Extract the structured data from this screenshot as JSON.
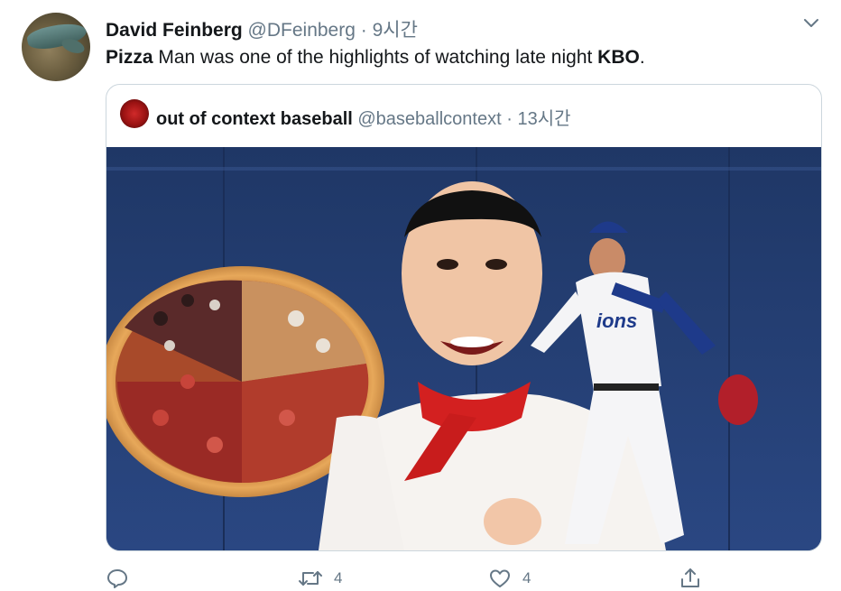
{
  "tweet": {
    "display_name": "David Feinberg",
    "handle": "@DFeinberg",
    "separator": " · ",
    "time": "9시간",
    "text_bold_1": "Pizza",
    "text_mid": " Man was one of the highlights of watching late night ",
    "text_bold_2": "KBO",
    "text_end": "."
  },
  "quoted": {
    "display_name": "out of context baseball",
    "handle": "@baseballcontext",
    "separator": " · ",
    "time": "13시간"
  },
  "actions": {
    "reply_count": "",
    "retweet_count": "4",
    "like_count": "4"
  },
  "icons": [
    "avatar",
    "chevron-down-icon",
    "reply-icon",
    "retweet-icon",
    "like-icon",
    "share-icon"
  ],
  "colors": {
    "text": "#14171a",
    "muted": "#657786",
    "border": "#ccd6dd",
    "wall": "#243e74"
  }
}
